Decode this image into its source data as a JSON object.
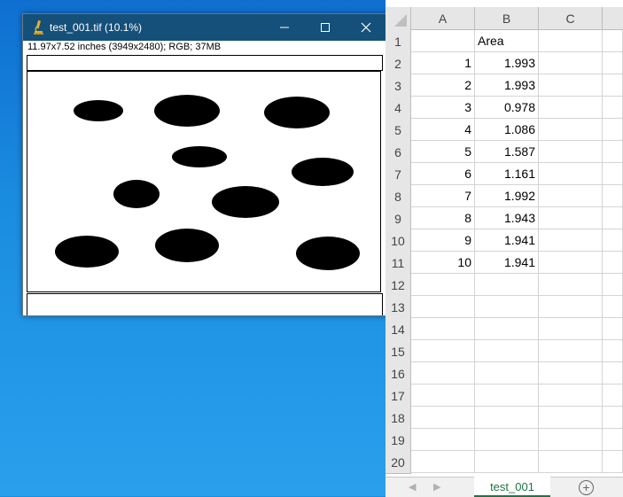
{
  "imagej": {
    "title": "test_001.tif (10.1%)",
    "info": "11.97x7.52 inches (3949x2480); RGB; 37MB",
    "controls": {
      "minimize": "minimize",
      "maximize": "maximize",
      "close": "close"
    },
    "particles_count": 10
  },
  "excel": {
    "columns": [
      "A",
      "B",
      "C"
    ],
    "header_row": {
      "a": "",
      "b": "Area"
    },
    "data_rows": [
      {
        "a": "1",
        "b": "1.993"
      },
      {
        "a": "2",
        "b": "1.993"
      },
      {
        "a": "3",
        "b": "0.978"
      },
      {
        "a": "4",
        "b": "1.086"
      },
      {
        "a": "5",
        "b": "1.587"
      },
      {
        "a": "6",
        "b": "1.161"
      },
      {
        "a": "7",
        "b": "1.992"
      },
      {
        "a": "8",
        "b": "1.943"
      },
      {
        "a": "9",
        "b": "1.941"
      },
      {
        "a": "10",
        "b": "1.941"
      }
    ],
    "row_numbers": [
      "1",
      "2",
      "3",
      "4",
      "5",
      "6",
      "7",
      "8",
      "9",
      "10",
      "11",
      "12",
      "13",
      "14",
      "15",
      "16",
      "17",
      "18",
      "19",
      "20"
    ],
    "sheet_tab": "test_001",
    "add_sheet_symbol": "+"
  },
  "colors": {
    "titlebar": "#14507a",
    "excel_accent": "#217346",
    "desktop": "#1a8fe0"
  }
}
